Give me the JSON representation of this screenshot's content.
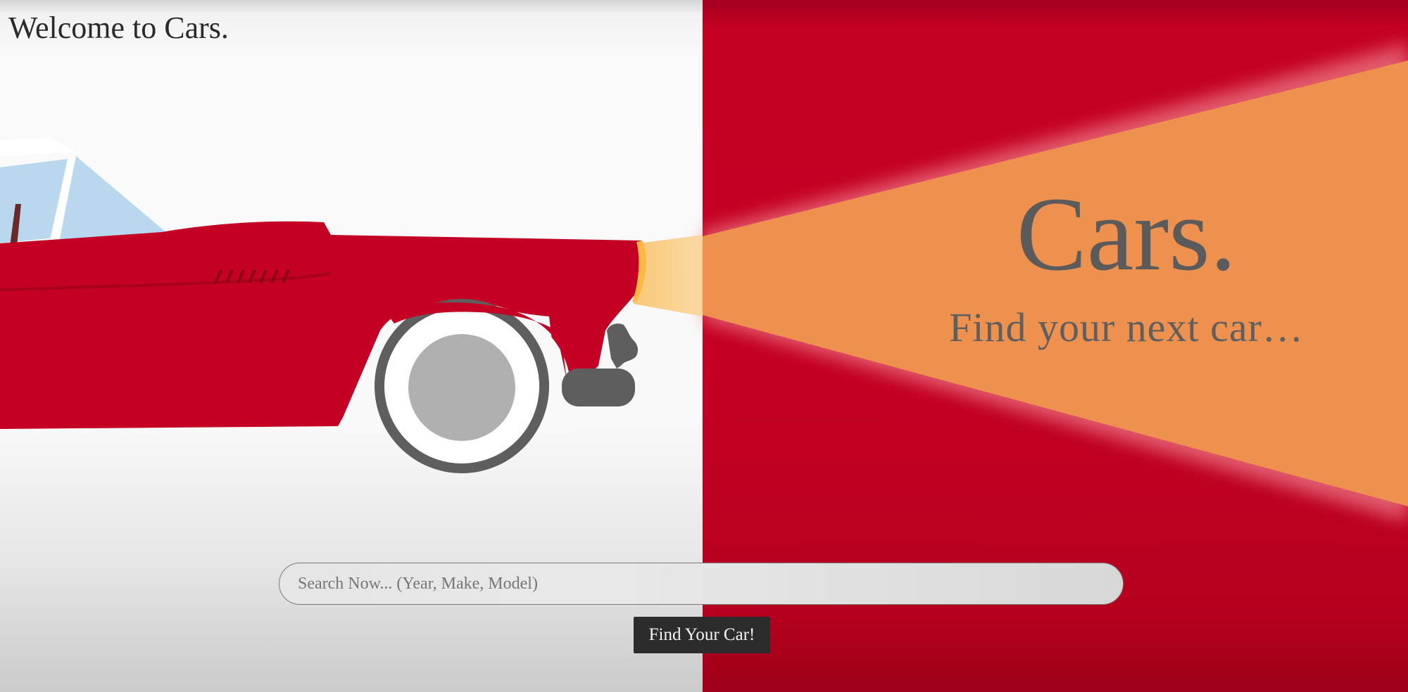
{
  "header": {
    "welcome_text": "Welcome to Cars."
  },
  "hero": {
    "title": "Cars.",
    "subtitle": "Find your next car…"
  },
  "search": {
    "placeholder": "Search Now... (Year, Make, Model)",
    "value": "",
    "button_label": "Find Your Car!"
  },
  "colors": {
    "car_red": "#c40024",
    "background_red": "#c40123",
    "light_beam": "#ee914e",
    "left_background": "#f9f9f9",
    "tire": "#5e5e5e",
    "hubcap": "#b0b0b0",
    "windshield": "#b9d8ed",
    "text_gray": "#5b5b5b",
    "button_dark": "#2c2c2c"
  }
}
